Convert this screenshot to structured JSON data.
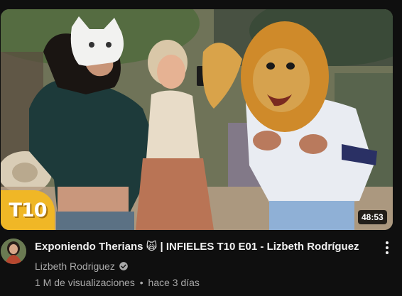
{
  "video": {
    "title": "Exponiendo Therians 🙀 | INFIELES T10 E01 - Lizbeth Rodríguez",
    "duration": "48:53",
    "thumbnail_badge": "T10",
    "channel_name": "Lizbeth Rodriguez",
    "views": "1 M de visualizaciones",
    "age": "hace 3 días",
    "separator": "•"
  },
  "icons": {
    "verified": "verified-check-icon",
    "menu": "more-vert-icon"
  },
  "colors": {
    "background": "#0f0f0f",
    "badge": "#f0b726",
    "secondary_text": "#aaaaaa"
  }
}
